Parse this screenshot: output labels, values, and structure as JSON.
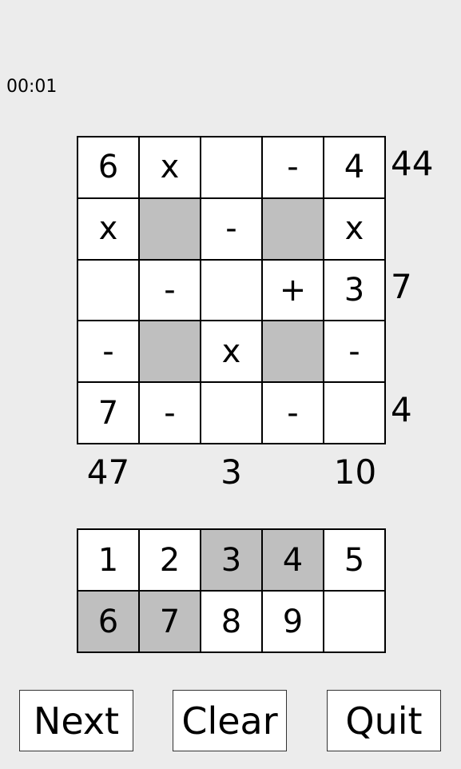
{
  "timer": "00:01",
  "grid": {
    "cells": [
      [
        {
          "v": "6"
        },
        {
          "v": "x"
        },
        {
          "v": ""
        },
        {
          "v": "-"
        },
        {
          "v": "4"
        }
      ],
      [
        {
          "v": "x"
        },
        {
          "v": "",
          "shaded": true
        },
        {
          "v": "-"
        },
        {
          "v": "",
          "shaded": true
        },
        {
          "v": "x"
        }
      ],
      [
        {
          "v": ""
        },
        {
          "v": "-"
        },
        {
          "v": ""
        },
        {
          "v": "+"
        },
        {
          "v": "3"
        }
      ],
      [
        {
          "v": "-"
        },
        {
          "v": "",
          "shaded": true
        },
        {
          "v": "x"
        },
        {
          "v": "",
          "shaded": true
        },
        {
          "v": "-"
        }
      ],
      [
        {
          "v": "7"
        },
        {
          "v": "-"
        },
        {
          "v": ""
        },
        {
          "v": "-"
        },
        {
          "v": ""
        }
      ]
    ],
    "row_clues": [
      "44",
      "7",
      "4"
    ],
    "col_clues": [
      "47",
      "3",
      "10"
    ]
  },
  "keypad": {
    "keys": [
      {
        "label": "1",
        "used": false
      },
      {
        "label": "2",
        "used": false
      },
      {
        "label": "3",
        "used": true
      },
      {
        "label": "4",
        "used": true
      },
      {
        "label": "5",
        "used": false
      },
      {
        "label": "6",
        "used": true
      },
      {
        "label": "7",
        "used": true
      },
      {
        "label": "8",
        "used": false
      },
      {
        "label": "9",
        "used": false
      },
      {
        "label": "",
        "used": false
      }
    ]
  },
  "buttons": {
    "next": "Next",
    "clear": "Clear",
    "quit": "Quit"
  }
}
